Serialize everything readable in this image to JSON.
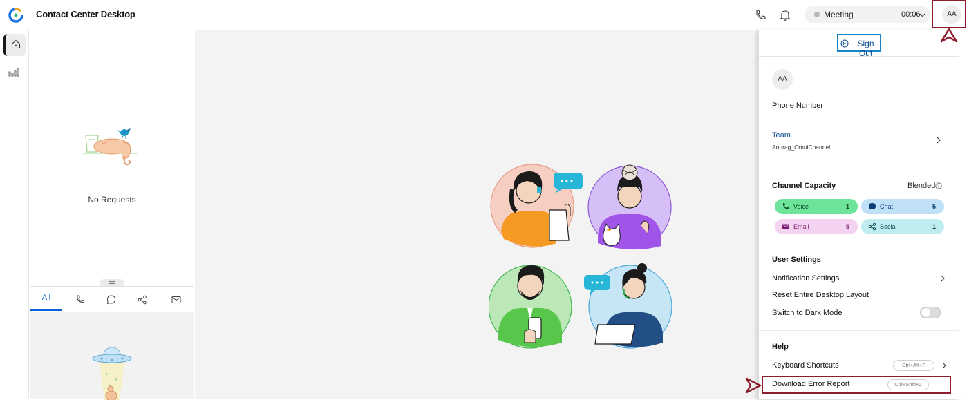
{
  "app": {
    "title": "Contact Center Desktop"
  },
  "topbar": {
    "state": "Meeting",
    "timer": "00:06",
    "avatar_initials": "AA",
    "icons": [
      "phone-icon",
      "bell-icon",
      "chevron-down-icon"
    ]
  },
  "leftnav": {
    "icons": [
      "home-icon",
      "stats-icon"
    ]
  },
  "requests": {
    "empty_label": "No Requests"
  },
  "filter_tabs": {
    "all_label": "All",
    "icons": [
      "phone-icon",
      "chat-bubble-icon",
      "share-icon",
      "mail-icon"
    ]
  },
  "profile": {
    "sign_out_label": "Sign Out",
    "avatar_initials": "AA",
    "phone_number_label": "Phone Number",
    "team_label": "Team",
    "team_value": "Anurag_OmniChannel",
    "channel_capacity_label": "Channel Capacity",
    "blended_label": "Blended",
    "channels": [
      {
        "label": "Voice",
        "count": "1",
        "icon": "phone-icon",
        "color": "#6ee49a",
        "text": "#0e4a26"
      },
      {
        "label": "Chat",
        "count": "5",
        "icon": "chat-bubble-icon",
        "color": "#bfe0f7",
        "text": "#0b3c78"
      },
      {
        "label": "Email",
        "count": "5",
        "icon": "mail-icon",
        "color": "#f3d3f0",
        "text": "#7a1a70"
      },
      {
        "label": "Social",
        "count": "1",
        "icon": "share-icon",
        "color": "#bfecef",
        "text": "#0b4b52"
      }
    ],
    "user_settings_label": "User Settings",
    "notification_settings_label": "Notification Settings",
    "reset_layout_label": "Reset Entire Desktop Layout",
    "dark_mode_label": "Switch to Dark Mode",
    "help_label": "Help",
    "keyboard_shortcuts_label": "Keyboard Shortcuts",
    "keyboard_shortcuts_key": "Ctrl+Alt+F",
    "download_error_label": "Download Error Report",
    "download_error_key": "Ctrl+Shift+2"
  },
  "colors": {
    "accent": "#0a5edc",
    "highlight": "#8b1d2c"
  }
}
